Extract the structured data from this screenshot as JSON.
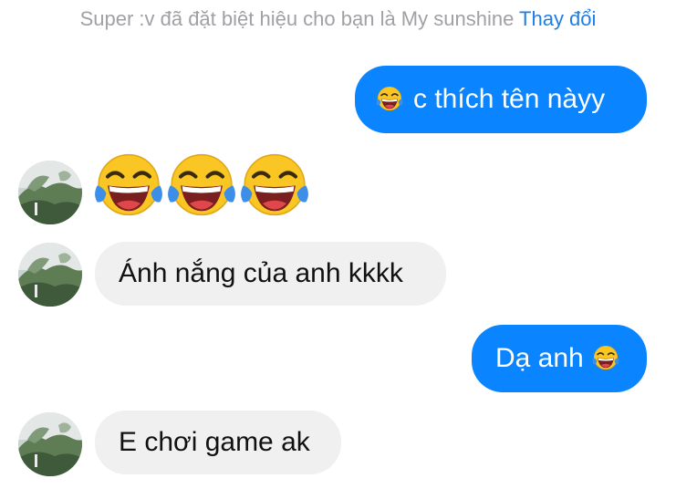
{
  "notice": {
    "text": "Super :v đã đặt biệt hiệu cho bạn là My sunshine",
    "link": "Thay đổi"
  },
  "messages": [
    {
      "id": "m1",
      "direction": "out",
      "text": "c thích tên nàyy",
      "emoji": "face-with-tears-of-joy"
    },
    {
      "id": "m2",
      "direction": "in",
      "emoji_only": [
        "face-with-tears-of-joy",
        "face-with-tears-of-joy",
        "face-with-tears-of-joy"
      ]
    },
    {
      "id": "m3",
      "direction": "in",
      "text": "Ánh nắng của anh kkkk"
    },
    {
      "id": "m4",
      "direction": "out",
      "text": "Dạ anh",
      "emoji": "face-with-tears-of-joy"
    },
    {
      "id": "m5",
      "direction": "in",
      "text": "E chơi game ak"
    }
  ],
  "colors": {
    "outgoing_bubble": "#0a84ff",
    "incoming_bubble": "#f0f0f0",
    "notice_text": "#a0a0a5",
    "link": "#1e7ee8"
  }
}
